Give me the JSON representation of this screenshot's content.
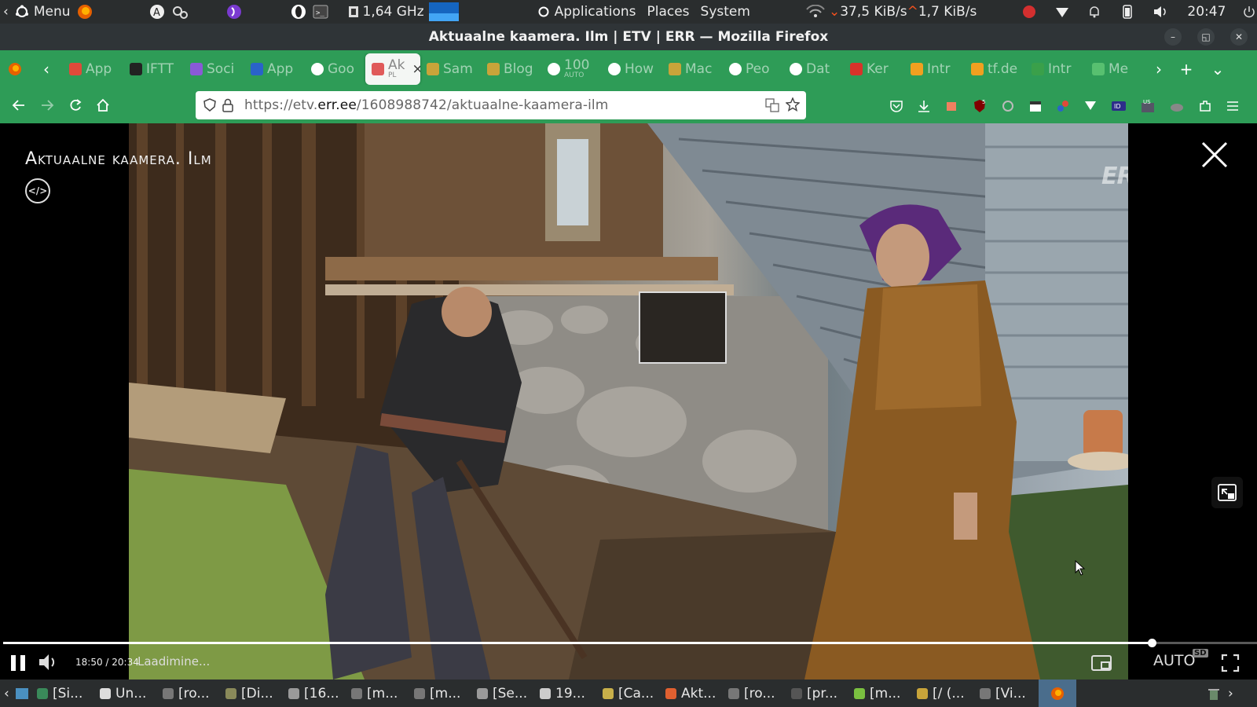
{
  "system_panel": {
    "menu_label": "Menu",
    "cpu_freq": "1,64 GHz",
    "applications": "Applications",
    "places": "Places",
    "system": "System",
    "net_down": "37,5 KiB/s",
    "net_up": "1,7 KiB/s",
    "clock": "20:47"
  },
  "window": {
    "title": "Aktuaalne kaamera. Ilm | ETV | ERR — Mozilla Firefox"
  },
  "tabs": [
    {
      "label": "App",
      "icon": "colorful-icon",
      "color": "#e04a3a"
    },
    {
      "label": "IFTT",
      "icon": "ifttt-icon",
      "color": "#222222"
    },
    {
      "label": "Soci",
      "icon": "social-icon",
      "color": "#8a5ad6"
    },
    {
      "label": "App",
      "icon": "code-icon",
      "color": "#2a63c9"
    },
    {
      "label": "Goo",
      "icon": "google-icon",
      "color": "#ffffff"
    },
    {
      "label": "Ak",
      "sublabel": "PL",
      "icon": "clock-icon",
      "color": "#e05a5a",
      "active": true
    },
    {
      "label": "Sam",
      "icon": "dots-icon",
      "color": "#c8a43a"
    },
    {
      "label": "Blog",
      "icon": "dots-icon",
      "color": "#c8a43a"
    },
    {
      "label": "100",
      "sublabel": "AUTO",
      "icon": "google-icon",
      "color": "#ffffff"
    },
    {
      "label": "How",
      "icon": "google-icon",
      "color": "#ffffff"
    },
    {
      "label": "Mac",
      "icon": "dots-icon",
      "color": "#c8a43a"
    },
    {
      "label": "Peo",
      "icon": "google-icon",
      "color": "#ffffff"
    },
    {
      "label": "Dat",
      "icon": "google-icon",
      "color": "#ffffff"
    },
    {
      "label": "Ker",
      "icon": "k-icon",
      "color": "#d8332a"
    },
    {
      "label": "Intr",
      "icon": "pin-icon",
      "color": "#f0a020"
    },
    {
      "label": "tf.de",
      "icon": "pin-icon",
      "color": "#f0a020"
    },
    {
      "label": "Intr",
      "icon": "drive-icon",
      "color": "#3aa04a"
    },
    {
      "label": "Me",
      "icon": "cloud-icon",
      "color": "#58c070"
    }
  ],
  "urlbar": {
    "url_prefix": "https://etv.",
    "url_domain": "err.ee",
    "url_path": "/1608988742/aktuaalne-kaamera-ilm"
  },
  "player": {
    "title": "Aktuaalne kaamera. Ilm",
    "watermark": "ERR",
    "time": "18:50 / 20:34",
    "status": "Laadimine...",
    "quality": "AUTO",
    "quality_badge": "SD",
    "progress_fraction": 0.916
  },
  "taskbar": {
    "items": [
      {
        "label": "[Si...",
        "color": "#3a8a5a"
      },
      {
        "label": "Un...",
        "color": "#dddddd"
      },
      {
        "label": "[ro...",
        "color": "#777777"
      },
      {
        "label": "[Di...",
        "color": "#8a8a5a"
      },
      {
        "label": "[16...",
        "color": "#9a9a9a"
      },
      {
        "label": "[m...",
        "color": "#777777"
      },
      {
        "label": "[m...",
        "color": "#777777"
      },
      {
        "label": "[Se...",
        "color": "#9a9a9a"
      },
      {
        "label": "19...",
        "color": "#cccccc"
      },
      {
        "label": "[Ca...",
        "color": "#c8b04a"
      },
      {
        "label": "Akt...",
        "color": "#e06030"
      },
      {
        "label": "[ro...",
        "color": "#777777"
      },
      {
        "label": "[pr...",
        "color": "#555555"
      },
      {
        "label": "[m...",
        "color": "#7ac040"
      },
      {
        "label": "[/ (...",
        "color": "#c8a43a"
      },
      {
        "label": "[Vi...",
        "color": "#777777"
      }
    ]
  }
}
